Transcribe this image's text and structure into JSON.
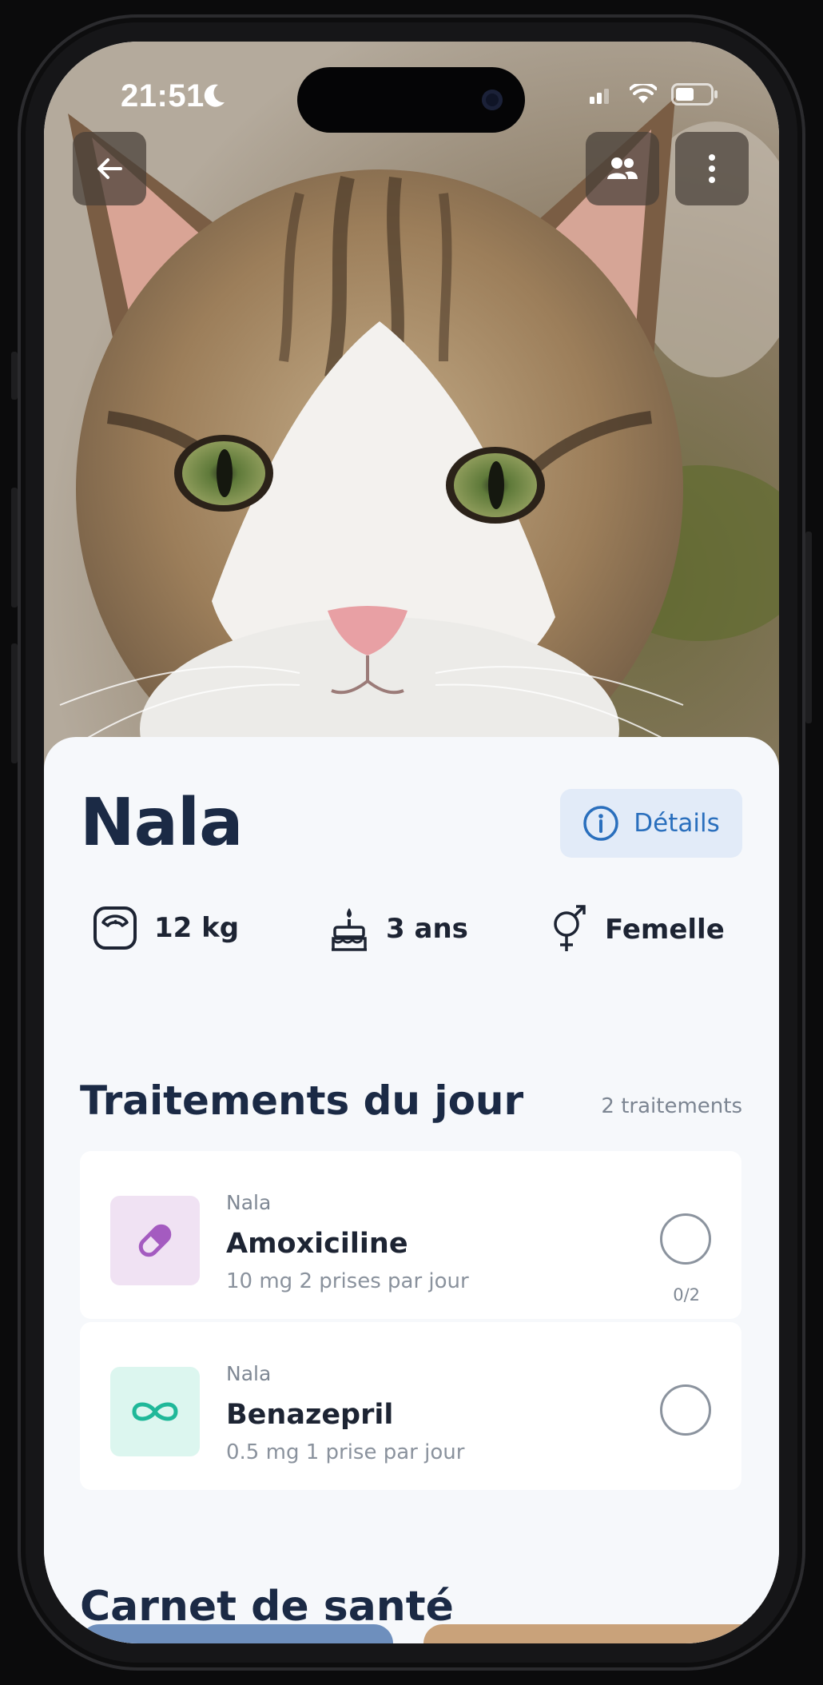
{
  "status_bar": {
    "time": "21:51"
  },
  "pet": {
    "name": "Nala"
  },
  "header_actions": {
    "details_label": "Détails"
  },
  "stats": [
    {
      "icon": "scale-icon",
      "label": "12 kg"
    },
    {
      "icon": "birthday-cake-icon",
      "label": "3 ans"
    },
    {
      "icon": "gender-icon",
      "label": "Femelle"
    }
  ],
  "treatments": {
    "title": "Traitements du jour",
    "count_label": "2 traitements",
    "items": [
      {
        "owner": "Nala",
        "name": "Amoxiciline",
        "dose": "10 mg 2 prises par jour",
        "progress": "0/2",
        "icon": "pill-icon",
        "icon_color": "#a45bc0",
        "icon_bg": "#f0e2f3"
      },
      {
        "owner": "Nala",
        "name": "Benazepril",
        "dose": "0.5 mg 1 prise par jour",
        "progress": "",
        "icon": "infinity-icon",
        "icon_color": "#1fb899",
        "icon_bg": "#dcf6ef"
      }
    ]
  },
  "health_book": {
    "title": "Carnet de santé"
  },
  "colors": {
    "primary_text": "#1b2a45",
    "accent_blue": "#2a6fbd",
    "details_bg": "#e2ebf8",
    "tile_blue": "#6e8fbd",
    "tile_tan": "#c9a27a"
  }
}
